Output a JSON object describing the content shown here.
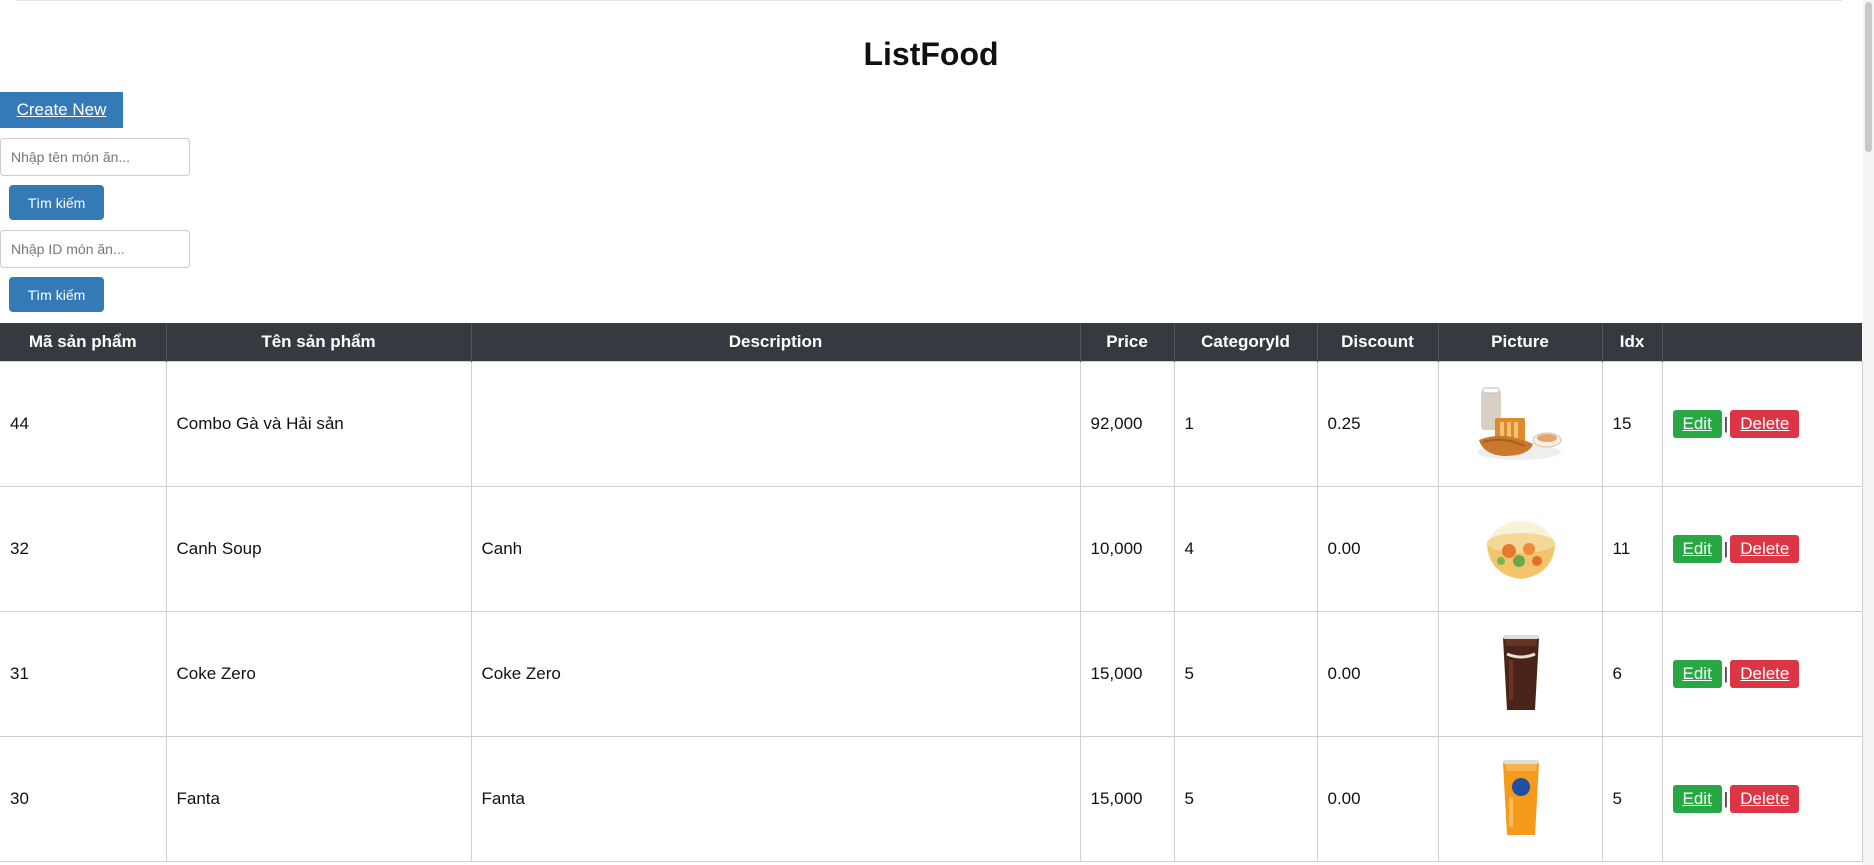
{
  "page": {
    "title": "ListFood",
    "create_label": "Create New"
  },
  "search_name": {
    "placeholder": "Nhập tên món ăn...",
    "button_label": "Tìm kiếm"
  },
  "search_id": {
    "placeholder": "Nhập ID món ăn...",
    "button_label": "Tìm kiếm"
  },
  "table": {
    "headers": [
      "Mã sản phẩm",
      "Tên sản phẩm",
      "Description",
      "Price",
      "CategoryId",
      "Discount",
      "Picture",
      "Idx",
      ""
    ],
    "edit_label": "Edit",
    "delete_label": "Delete",
    "separator": "|",
    "rows": [
      {
        "id": "44",
        "name": "Combo Gà và Hải sản",
        "description": "",
        "price": "92,000",
        "category_id": "1",
        "discount": "0.25",
        "picture": "combo-chicken-seafood",
        "idx": "15"
      },
      {
        "id": "32",
        "name": "Canh Soup",
        "description": "Canh",
        "price": "10,000",
        "category_id": "4",
        "discount": "0.00",
        "picture": "soup-bowl",
        "idx": "11"
      },
      {
        "id": "31",
        "name": "Coke Zero",
        "description": "Coke Zero",
        "price": "15,000",
        "category_id": "5",
        "discount": "0.00",
        "picture": "coke-cup",
        "idx": "6"
      },
      {
        "id": "30",
        "name": "Fanta",
        "description": "Fanta",
        "price": "15,000",
        "category_id": "5",
        "discount": "0.00",
        "picture": "fanta-cup",
        "idx": "5"
      }
    ]
  },
  "colors": {
    "primary": "#337ab7",
    "header_bg": "#343a40",
    "edit": "#28a745",
    "delete": "#dc3545"
  }
}
